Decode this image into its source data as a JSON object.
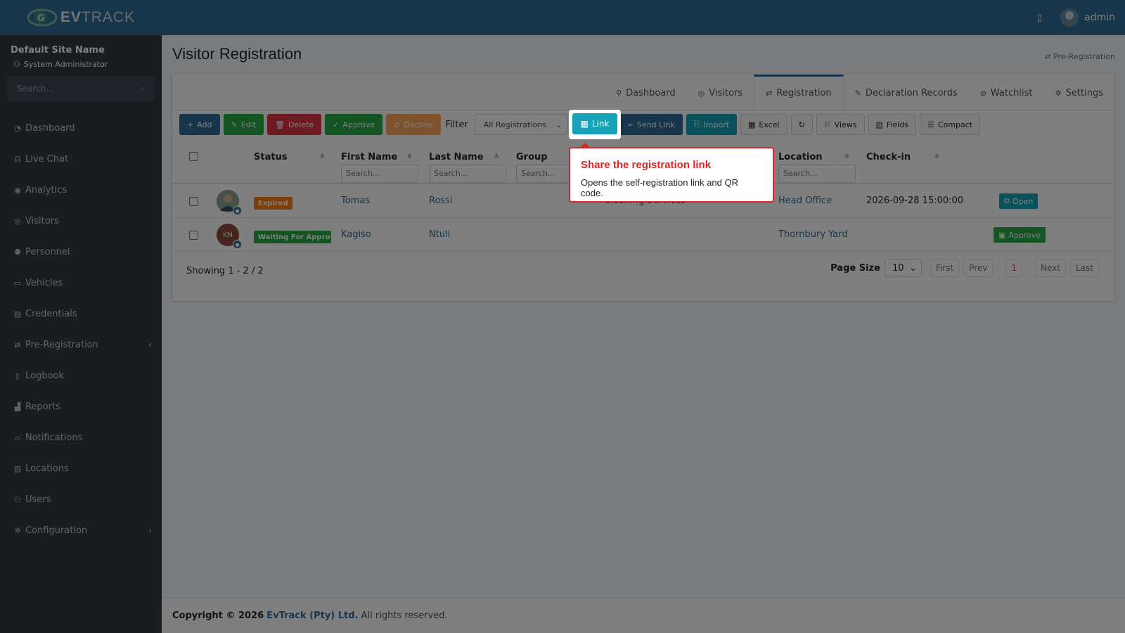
{
  "brand": {
    "name_bold": "EV",
    "name_rest": "TRACK"
  },
  "topbar": {
    "user": "admin"
  },
  "sidebar": {
    "site_name": "Default Site Name",
    "role": "System Administrator",
    "search_placeholder": "Search...",
    "items": [
      {
        "label": "Dashboard",
        "icon": "dashboard-icon"
      },
      {
        "label": "Live Chat",
        "icon": "headset-icon"
      },
      {
        "label": "Analytics",
        "icon": "target-icon"
      },
      {
        "label": "Visitors",
        "icon": "eye-icon"
      },
      {
        "label": "Personnel",
        "icon": "person-icon"
      },
      {
        "label": "Vehicles",
        "icon": "car-icon"
      },
      {
        "label": "Credentials",
        "icon": "badge-icon"
      },
      {
        "label": "Pre-Registration",
        "icon": "exchange-icon",
        "chevron": "‹"
      },
      {
        "label": "Logbook",
        "icon": "book-icon"
      },
      {
        "label": "Reports",
        "icon": "chart-icon"
      },
      {
        "label": "Notifications",
        "icon": "bell-icon"
      },
      {
        "label": "Locations",
        "icon": "map-icon"
      },
      {
        "label": "Users",
        "icon": "users-icon"
      },
      {
        "label": "Configuration",
        "icon": "cog-icon",
        "chevron": "‹"
      }
    ]
  },
  "page": {
    "title": "Visitor Registration",
    "breadcrumb": "Pre-Registration"
  },
  "tabs": [
    {
      "label": "Dashboard",
      "icon": "walk-icon"
    },
    {
      "label": "Visitors",
      "icon": "eye-icon"
    },
    {
      "label": "Registration",
      "icon": "exchange-icon",
      "active": true
    },
    {
      "label": "Declaration Records",
      "icon": "edit-icon"
    },
    {
      "label": "Watchlist",
      "icon": "ban-icon"
    },
    {
      "label": "Settings",
      "icon": "gear-icon"
    }
  ],
  "toolbar": {
    "add": "Add",
    "edit": "Edit",
    "delete": "Delete",
    "approve": "Approve",
    "decline": "Decline",
    "filter_label": "Filter",
    "filter_value": "All Registrations",
    "link": "Link",
    "send_link": "Send Link",
    "import": "Import",
    "excel": "Excel",
    "views": "Views",
    "fields": "Fields",
    "compact": "Compact"
  },
  "table": {
    "columns": {
      "status": "Status",
      "first_name": "First Name",
      "last_name": "Last Name",
      "group": "Group",
      "location": "Location",
      "checkin": "Check-in"
    },
    "search_placeholder": "Search...",
    "rows": [
      {
        "status": "Expired",
        "status_color": "#fd7e14",
        "first_name": "Tomas",
        "last_name": "Rossi",
        "company": "Cleaning Services",
        "location": "Head Office",
        "checkin": "2026-09-28 15:00:00",
        "action": "Open",
        "action_color": "#17a2b8"
      },
      {
        "status": "Waiting For Approv",
        "status_color": "#28a745",
        "initials": "KN",
        "first_name": "Kagiso",
        "last_name": "Ntuli",
        "company": "",
        "location": "Thornbury Yard",
        "checkin": "",
        "action": "Approve",
        "action_color": "#28a745"
      }
    ]
  },
  "pagination": {
    "showing": "Showing 1 - 2 / 2",
    "page_size_label": "Page Size",
    "page_size": "10",
    "first": "First",
    "prev": "Prev",
    "current": "1",
    "next": "Next",
    "last": "Last"
  },
  "footer": {
    "copyright": "Copyright © 2026",
    "company": "EvTrack (Pty) Ltd.",
    "rights": "All rights reserved."
  },
  "tooltip": {
    "title": "Share the registration link",
    "body": "Opens the self-registration link and QR code."
  }
}
